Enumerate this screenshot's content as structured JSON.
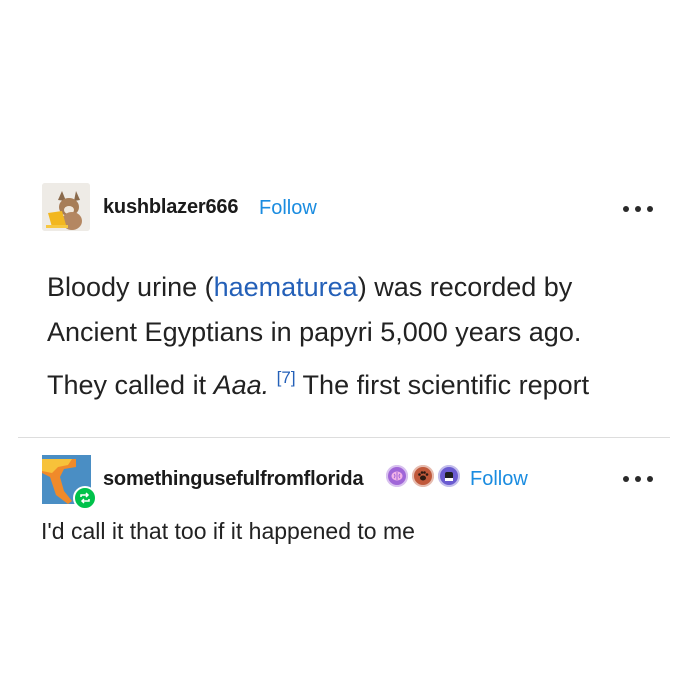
{
  "original_post": {
    "username": "kushblazer666",
    "follow_label": "Follow",
    "quote_lines": {
      "l1_a": "Bloody urine (",
      "l1_link": "haematurea",
      "l1_b": ") was recorded by",
      "l2": "Ancient Egyptians in papyri 5,000 years ago.",
      "l3_a": "They called it ",
      "l3_em": "Aaa.",
      "l3_ref": "[7]",
      "l3_b": " The first scientific report"
    },
    "avatar_icon": "fox-laptop-avatar"
  },
  "reply": {
    "username": "somethingusefulfromflorida",
    "follow_label": "Follow",
    "text": "I'd call it that too if it happened to me",
    "badges": [
      {
        "icon": "brain-badge-icon",
        "color": "#a066d8"
      },
      {
        "icon": "paw-badge-icon",
        "color": "#c0583a"
      },
      {
        "icon": "glove-badge-icon",
        "color": "#6a5bd0"
      }
    ],
    "avatar_icon": "florida-map-avatar"
  },
  "colors": {
    "accent": "#1a8ce0",
    "link": "#2460b8",
    "reblog": "#00c24b"
  }
}
